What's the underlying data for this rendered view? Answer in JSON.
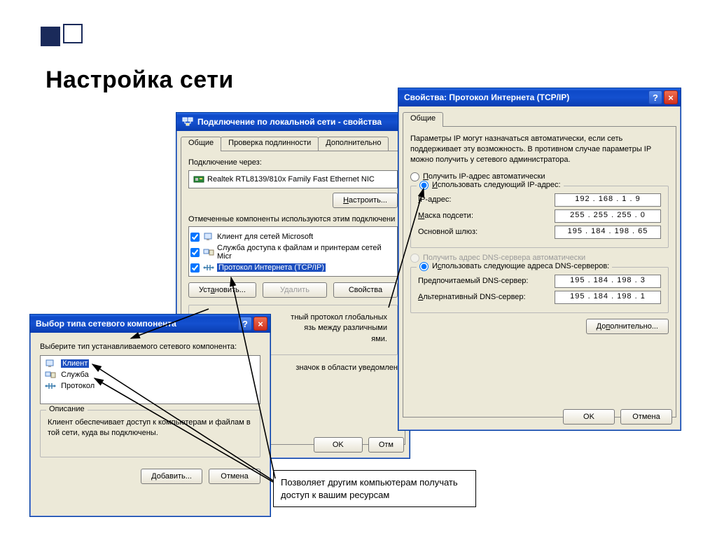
{
  "slide": {
    "title": "Настройка сети",
    "caption": "Позволяет другим компьютерам получать доступ к вашим ресурсам"
  },
  "window_conn": {
    "title": "Подключение по локальной сети - свойства",
    "tabs": {
      "t1": "Общие",
      "t2": "Проверка подлинности",
      "t3": "Дополнительно"
    },
    "connect_via_label": "Подключение через:",
    "adapter": "Realtek RTL8139/810x Family Fast Ethernet NIC",
    "configure_btn": "Настроить...",
    "components_label": "Отмеченные компоненты используются этим подключени",
    "items": {
      "client": "Клиент для сетей Microsoft",
      "fileshare": "Служба доступа к файлам и принтерам сетей Micr",
      "tcpip": "Протокол Интернета (TCP/IP)"
    },
    "install_btn": "Установить...",
    "delete_btn": "Удалить",
    "props_btn": "Свойства",
    "desc_text1": "тный протокол глобальных",
    "desc_text2": "язь между различными",
    "desc_text3": "ями.",
    "tray_text": "значок в области уведомлен",
    "ok_btn": "OK",
    "cancel_btn": "Отм"
  },
  "window_select": {
    "title": "Выбор типа сетевого компонента",
    "instruction": "Выберите тип устанавливаемого сетевого компонента:",
    "items": {
      "client": "Клиент",
      "service": "Служба",
      "protocol": "Протокол"
    },
    "desc_label": "Описание",
    "desc_text": "Клиент обеспечивает доступ к компьютерам и файлам в той сети, куда вы подключены.",
    "add_btn": "Добавить...",
    "cancel_btn": "Отмена"
  },
  "window_tcpip": {
    "title": "Свойства: Протокол Интернета (TCP/IP)",
    "tab": "Общие",
    "intro": "Параметры IP могут назначаться автоматически, если сеть поддерживает эту возможность. В противном случае параметры IP можно получить у сетевого администратора.",
    "radio_auto_ip": "Получить IP-адрес автоматически",
    "radio_manual_ip": "Использовать следующий IP-адрес:",
    "ip_label": "IP-адрес:",
    "mask_label": "Маска подсети:",
    "gw_label": "Основной шлюз:",
    "ip_value": "192 . 168 .   1  .   9",
    "mask_value": "255 . 255 . 255 .   0",
    "gw_value": "195 . 184 . 198 .  65",
    "radio_auto_dns": "Получить адрес DNS-сервера автоматически",
    "radio_manual_dns": "Использовать следующие адреса DNS-серверов:",
    "dns1_label": "Предпочитаемый DNS-сервер:",
    "dns2_label": "Альтернативный DNS-сервер:",
    "dns1_value": "195 . 184 . 198 .   3",
    "dns2_value": "195 . 184 . 198 .   1",
    "adv_btn": "Дополнительно...",
    "ok_btn": "OK",
    "cancel_btn": "Отмена"
  }
}
